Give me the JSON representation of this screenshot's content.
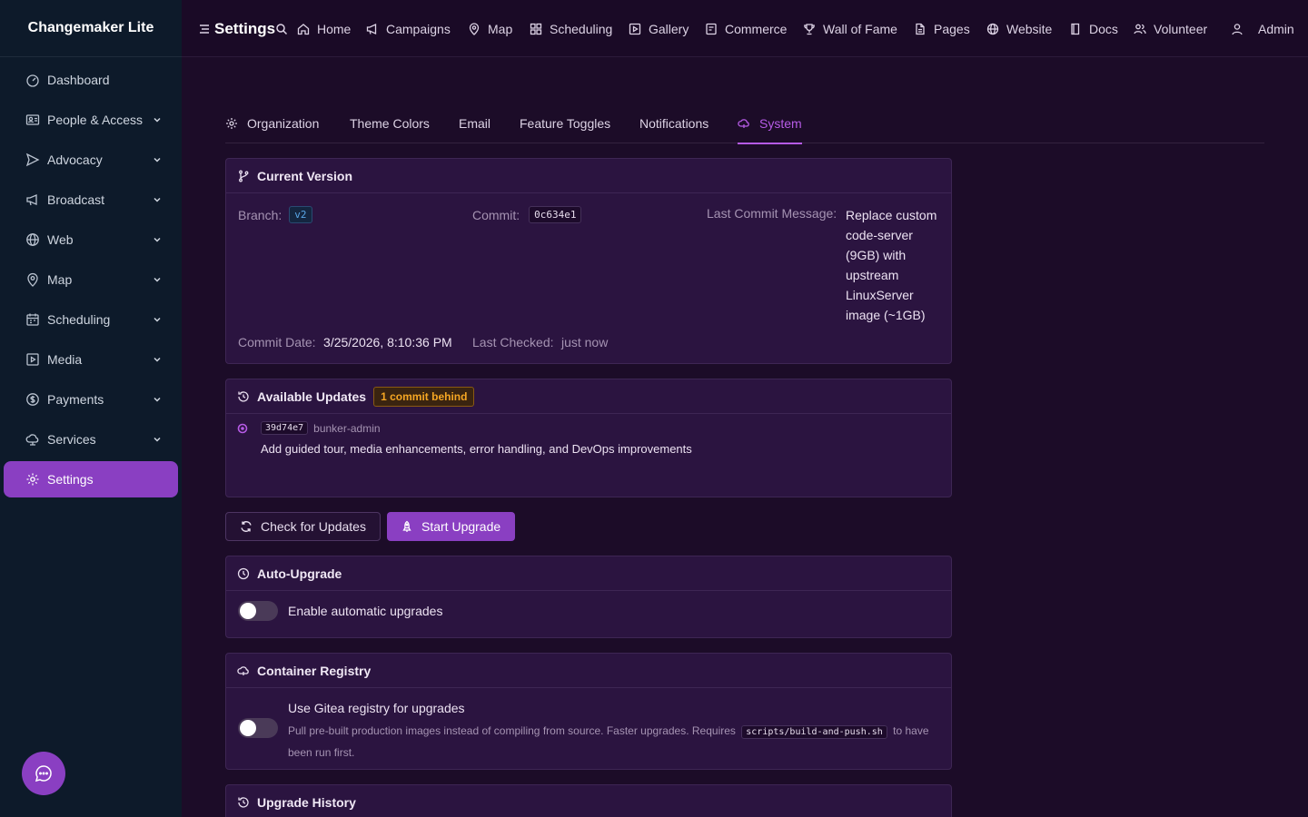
{
  "brand": "Changemaker Lite",
  "sidebar": {
    "items": [
      {
        "label": "Dashboard"
      },
      {
        "label": "People & Access"
      },
      {
        "label": "Advocacy"
      },
      {
        "label": "Broadcast"
      },
      {
        "label": "Web"
      },
      {
        "label": "Map"
      },
      {
        "label": "Scheduling"
      },
      {
        "label": "Media"
      },
      {
        "label": "Payments"
      },
      {
        "label": "Services"
      },
      {
        "label": "Settings"
      }
    ]
  },
  "topbar": {
    "title": "Settings",
    "links": [
      {
        "label": "Home"
      },
      {
        "label": "Campaigns"
      },
      {
        "label": "Map"
      },
      {
        "label": "Scheduling"
      },
      {
        "label": "Gallery"
      },
      {
        "label": "Commerce"
      },
      {
        "label": "Wall of Fame"
      },
      {
        "label": "Pages"
      },
      {
        "label": "Website"
      },
      {
        "label": "Docs"
      },
      {
        "label": "Volunteer"
      }
    ],
    "user": "Admin"
  },
  "tabs": [
    {
      "label": "Organization"
    },
    {
      "label": "Theme Colors"
    },
    {
      "label": "Email"
    },
    {
      "label": "Feature Toggles"
    },
    {
      "label": "Notifications"
    },
    {
      "label": "System"
    }
  ],
  "version": {
    "title": "Current Version",
    "branch_label": "Branch:",
    "branch": "v2",
    "commit_label": "Commit:",
    "commit": "0c634e1",
    "message_label": "Last Commit Message:",
    "message_lines": [
      "Replace custom",
      "code-server",
      "(9GB) with",
      "upstream",
      "LinuxServer",
      "image (~1GB)"
    ],
    "date_label": "Commit Date:",
    "date": "3/25/2026, 8:10:36 PM",
    "checked_label": "Last Checked:",
    "checked": "just now"
  },
  "updates": {
    "title": "Available Updates",
    "badge": "1 commit behind",
    "commit_hash": "39d74e7",
    "commit_author": "bunker-admin",
    "commit_message": "Add guided tour, media enhancements, error handling, and DevOps improvements"
  },
  "actions": {
    "check": "Check for Updates",
    "upgrade": "Start Upgrade"
  },
  "auto_upgrade": {
    "title": "Auto-Upgrade",
    "toggle_label": "Enable automatic upgrades",
    "enabled": false
  },
  "registry": {
    "title": "Container Registry",
    "toggle_label": "Use Gitea registry for upgrades",
    "desc_before": "Pull pre-built production images instead of compiling from source. Faster upgrades. Requires",
    "desc_code": "scripts/build-and-push.sh",
    "desc_after": "to have",
    "desc_line2": "been run first.",
    "enabled": false
  },
  "history": {
    "title": "Upgrade History"
  },
  "colors": {
    "accent": "#8a3fc2",
    "accent_text": "#b65be6",
    "sidebar_bg": "#0d1a2a",
    "page_bg": "#1c0c28",
    "card_bg": "#2b1440",
    "warning": "#f5a623"
  }
}
